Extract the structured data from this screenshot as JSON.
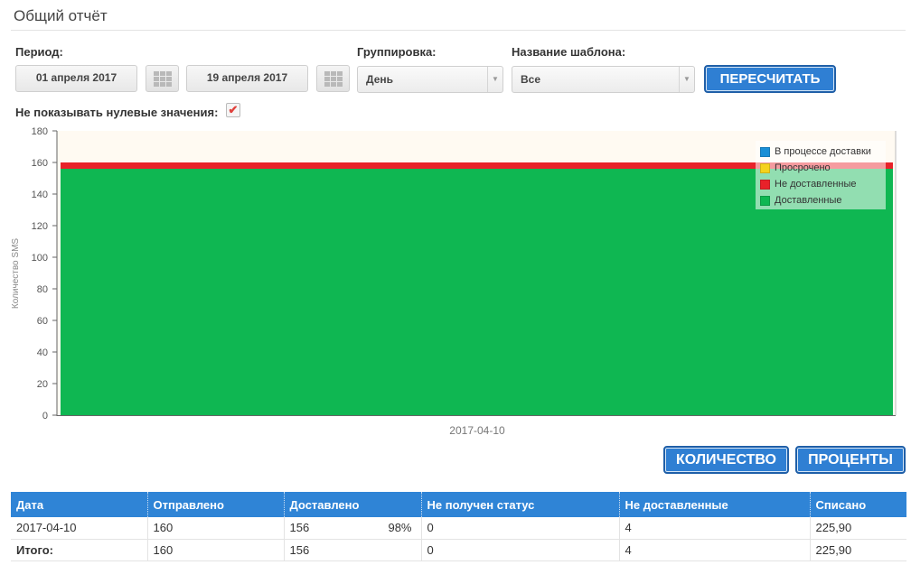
{
  "page": {
    "title": "Общий отчёт"
  },
  "filters": {
    "period_label": "Период:",
    "date_from": "01 апреля 2017",
    "date_to": "19 апреля 2017",
    "grouping_label": "Группировка:",
    "grouping_value": "День",
    "template_label": "Название шаблона:",
    "template_value": "Все",
    "recalc_button": "ПЕРЕСЧИТАТЬ",
    "hide_zero_label": "Не показывать нулевые значения:",
    "hide_zero_checked": true,
    "check_mark": "✔"
  },
  "chart_data": {
    "type": "area",
    "x": [
      "2017-04-10"
    ],
    "xlabel": "",
    "ylabel": "Количество SMS",
    "ylim": [
      0,
      180
    ],
    "yticks": [
      0,
      20,
      40,
      60,
      80,
      100,
      120,
      140,
      160,
      180
    ],
    "grid": false,
    "legend_position": "top-right",
    "series": [
      {
        "name": "В процессе доставки",
        "values": [
          0
        ],
        "color": "#1a8fd6"
      },
      {
        "name": "Просрочено",
        "values": [
          0
        ],
        "color": "#f5d21c"
      },
      {
        "name": "Не доставленные",
        "values": [
          4
        ],
        "color": "#e8222a"
      },
      {
        "name": "Доставленные",
        "values": [
          156
        ],
        "color": "#0fb752"
      }
    ],
    "stacking_order_bottom_to_top": [
      "Доставленные",
      "Не доставленные",
      "Просрочено",
      "В процессе доставки"
    ]
  },
  "view_buttons": {
    "count": "КОЛИЧЕСТВО",
    "percent": "ПРОЦЕНТЫ"
  },
  "table": {
    "headers": [
      "Дата",
      "Отправлено",
      "Доставлено",
      "Не получен статус",
      "Не доставленные",
      "Списано"
    ],
    "rows": [
      {
        "date": "2017-04-10",
        "sent": "160",
        "delivered": "156",
        "delivered_pct": "98%",
        "no_status": "0",
        "undelivered": "4",
        "charged": "225,90"
      }
    ],
    "total": {
      "label": "Итого:",
      "sent": "160",
      "delivered": "156",
      "no_status": "0",
      "undelivered": "4",
      "charged": "225,90"
    }
  }
}
